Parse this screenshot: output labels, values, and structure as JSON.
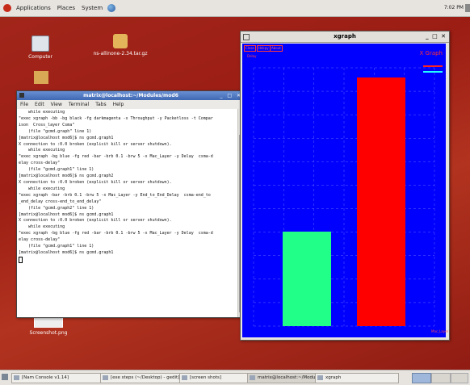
{
  "top_panel": {
    "menus": [
      "Applications",
      "Places",
      "System"
    ],
    "clock": "7:02 PM"
  },
  "desktop": {
    "icons": [
      {
        "label": "Computer"
      },
      {
        "label": "ns-allinone-2.34.tar.gz"
      },
      {
        "label": "Screenshot.png"
      }
    ]
  },
  "terminal": {
    "title": "matrix@localhost:~/Modules/mod6",
    "menu": [
      "File",
      "Edit",
      "View",
      "Terminal",
      "Tabs",
      "Help"
    ],
    "lines": [
      "    while executing",
      "\"exec xgraph -bb -bg black -fg darkmagenta -x Throughput -y Packetloss -t Compar",
      "ison  Cross_layer Csma\"",
      "    (file \"gcmd.graph\" line 1)",
      "[matrix@localhost mod6]$ ns gcmd.graph1",
      "X connection to :0.0 broken (explicit kill or server shutdown).",
      "    while executing",
      "\"exec xgraph -bg blue -fg red -bar -brb 0.1 -brw 5 -x Mac_Layer -y Delay  csma-d",
      "elay cross-delay\"",
      "    (file \"gcmd.graph1\" line 1)",
      "[matrix@localhost mod6]$ ns gcmd.graph2",
      "X connection to :0.0 broken (explicit kill or server shutdown).",
      "    while executing",
      "\"exec xgraph -bar -brb 0.1 -brw 5 -x Mac_Layer -y End_to_End_Delay  csma-end_to",
      "_end_delay cross-end_to_end_delay\"",
      "    (file \"gcmd.graph2\" line 1)",
      "[matrix@localhost mod6]$ ns gcmd.graph1",
      "X connection to :0.0 broken (explicit kill or server shutdown).",
      "    while executing",
      "\"exec xgraph -bg blue -fg red -bar -brb 0.1 -brw 5 -x Mac_Layer -y Delay  csma-d",
      "elay cross-delay\"",
      "    (file \"gcmd.graph1\" line 1)",
      "[matrix@localhost mod6]$ ns gcmd.graph1"
    ]
  },
  "xgraph": {
    "window_title": "xgraph",
    "buttons": [
      "Close",
      "Hdcpy",
      "About"
    ],
    "y_label": "Delay",
    "graph_title": "X Graph",
    "x_label": "Mac_Layer",
    "colors": {
      "background": "#0000ff",
      "foreground": "#ff2020",
      "bar1": "#ff0000",
      "bar2": "#22ff88",
      "legend2": "#22ffff"
    }
  },
  "chart_data": {
    "type": "bar",
    "title": "X Graph",
    "xlabel": "Mac_Layer",
    "ylabel": "Delay",
    "series": [
      {
        "values": [
          1.0
        ]
      },
      {
        "values": [
          0.38
        ]
      }
    ]
  },
  "bottom_panel": {
    "tasks": [
      {
        "label": "[Nam Console v1.14]"
      },
      {
        "label": "[exe steps (~/Desktop) - gedit]"
      },
      {
        "label": "[screen shots]"
      },
      {
        "label": "matrix@localhost:~/Modules..."
      },
      {
        "label": "xgraph"
      }
    ]
  }
}
